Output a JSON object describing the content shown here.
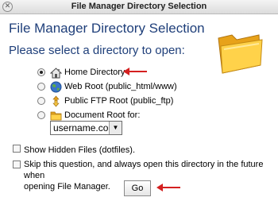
{
  "window": {
    "title": "File Manager Directory Selection"
  },
  "dialog": {
    "heading": "File Manager Directory Selection",
    "prompt": "Please select a directory to open:"
  },
  "options": [
    {
      "label": "Home Directory",
      "icon": "house-icon",
      "checked": true
    },
    {
      "label": "Web Root (public_html/www)",
      "icon": "globe-icon",
      "checked": false
    },
    {
      "label": "Public FTP Root (public_ftp)",
      "icon": "ftp-icon",
      "checked": false
    },
    {
      "label": "Document Root for:",
      "icon": "folder-icon",
      "checked": false
    }
  ],
  "domain_select": {
    "value": "username.com"
  },
  "checkboxes": {
    "show_hidden": "Show Hidden Files (dotfiles).",
    "skip_question_line1": "Skip this question, and always open this directory in the future when",
    "skip_question_line2": "opening File Manager."
  },
  "go_button": "Go",
  "colors": {
    "heading": "#1f3f7a",
    "arrow": "#d42020"
  }
}
